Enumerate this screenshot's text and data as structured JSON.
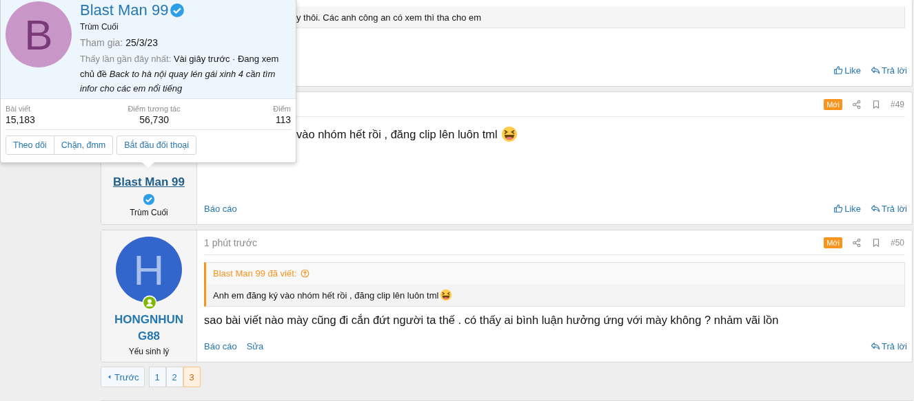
{
  "posts": [
    {
      "quote_text": "y thôi. Các anh công an có xem thì tha cho em",
      "actions": [
        {
          "label": "Like",
          "kind": "like"
        },
        {
          "label": "Trả lời",
          "kind": "reply"
        }
      ]
    },
    {
      "user": {
        "name": "Blast Man 99",
        "verified": true,
        "title": "Trùm Cuối"
      },
      "badge": "Mới",
      "number": "#49",
      "message": "vào nhóm hết rồi , đăng clip lên luôn tml",
      "emoji": true,
      "left_actions": [
        "Báo cáo"
      ],
      "actions": [
        {
          "label": "Like",
          "kind": "like"
        },
        {
          "label": "Trả lời",
          "kind": "reply"
        }
      ]
    },
    {
      "user": {
        "avatar_letter": "H",
        "name": "HONGNHUNG88",
        "online": true,
        "title": "Yếu sinh lý"
      },
      "time": "1 phút trước",
      "badge": "Mới",
      "number": "#50",
      "quote": {
        "author": "Blast Man 99 đã viết:",
        "text": "Anh em đăng ký vào nhóm hết rồi , đăng clip lên luôn tml",
        "emoji": true
      },
      "message": "sao bài viết nào mày cũng đi cắn đứt người ta thế . có thấy ai bình luận hưởng ứng với mày không ? nhảm vãi lồn",
      "left_actions": [
        "Báo cáo",
        "Sửa"
      ],
      "actions": [
        {
          "label": "Trả lời",
          "kind": "reply"
        }
      ]
    }
  ],
  "pagination": {
    "prev": "Trước",
    "pages": [
      {
        "label": "1",
        "selected": false
      },
      {
        "label": "2",
        "selected": false
      },
      {
        "label": "3",
        "selected": true
      }
    ]
  },
  "popup": {
    "avatar_letter": "B",
    "name": "Blast Man 99",
    "verified": true,
    "title": "Trùm Cuối",
    "joined_label": "Tham gia:",
    "joined": "25/3/23",
    "last_seen_label": "Thấy lần gần đây nhất:",
    "last_seen": "Vài giây trước · Đang xem chủ đề *Back to hà nội quay lén gái xinh 4 cần tìm infor cho các em nổi tiếng*",
    "stats": [
      {
        "label": "Bài viết",
        "value": "15,183"
      },
      {
        "label": "Điểm tương tác",
        "value": "56,730"
      },
      {
        "label": "Điểm",
        "value": "113"
      }
    ],
    "button_groups": [
      [
        "Theo dõi",
        "Chặn, đmm"
      ],
      [
        "Bắt đầu đối thoại"
      ]
    ]
  }
}
